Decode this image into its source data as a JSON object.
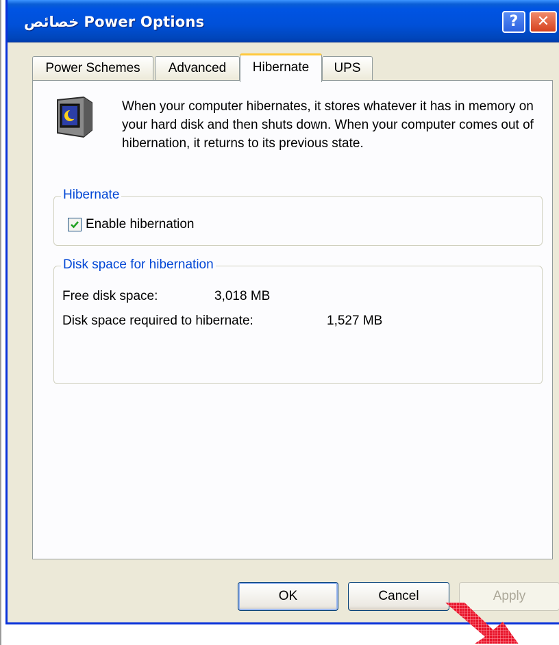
{
  "window": {
    "title": "خصائص Power Options",
    "help_symbol": "?",
    "close_symbol": "✕"
  },
  "tabs": [
    {
      "label": "Power Schemes",
      "active": false
    },
    {
      "label": "Advanced",
      "active": false
    },
    {
      "label": "Hibernate",
      "active": true
    },
    {
      "label": "UPS",
      "active": false
    }
  ],
  "intro": {
    "icon": "hibernate-monitor-icon",
    "text": "When your computer hibernates, it stores whatever it has in memory on your hard disk and then shuts down. When your computer comes out of hibernation, it returns to its previous state."
  },
  "hibernate_group": {
    "legend": "Hibernate",
    "enable_label": "Enable hibernation",
    "enable_checked": true
  },
  "disk_group": {
    "legend": "Disk space for hibernation",
    "free_label": "Free disk space:",
    "free_value": "3,018 MB",
    "required_label": "Disk space required to hibernate:",
    "required_value": "1,527 MB"
  },
  "buttons": {
    "ok": "OK",
    "cancel": "Cancel",
    "apply": "Apply"
  },
  "colors": {
    "titlebar": "#0054e3",
    "group_legend": "#0046d5",
    "active_tab_accent": "#ffc83c",
    "close_button": "#d6411f"
  }
}
